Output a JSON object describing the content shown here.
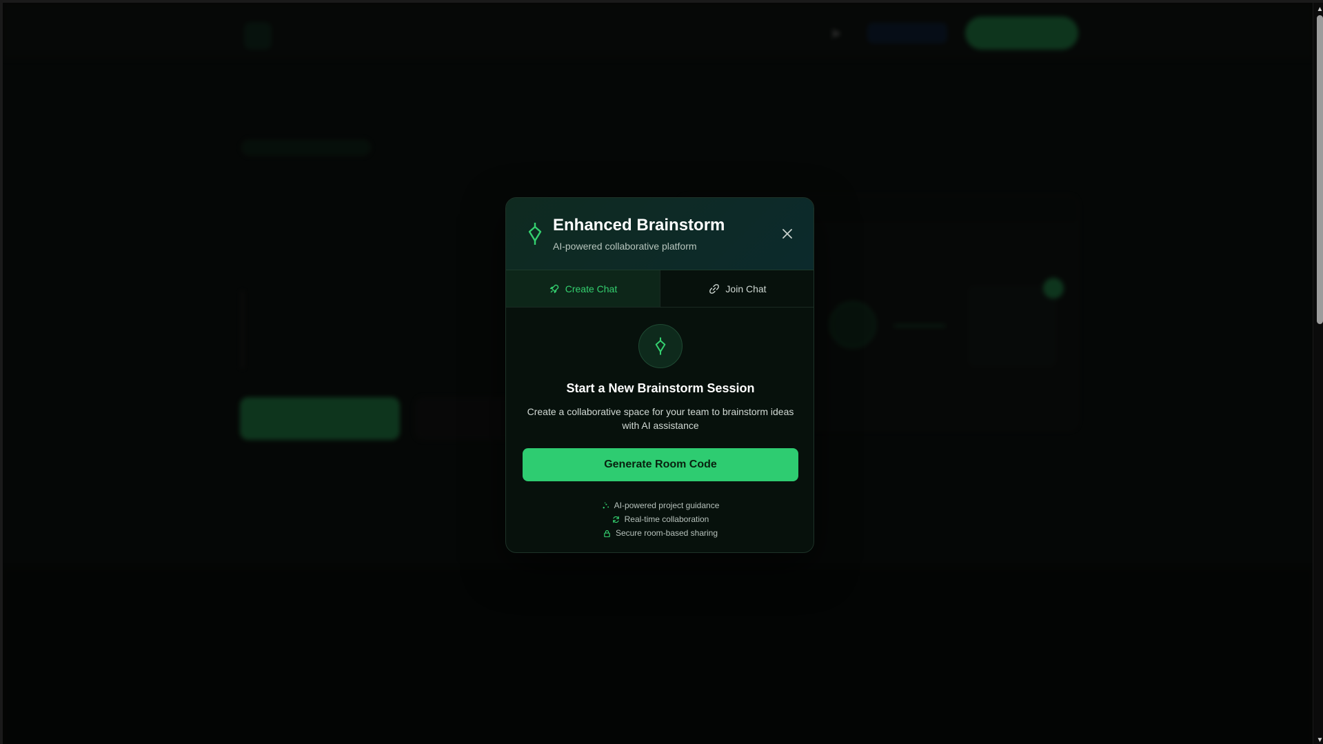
{
  "colors": {
    "accent": "#2ecc71",
    "accent_text": "#34d06f",
    "modal_bg": "#07110c",
    "header_gradient_start": "#0f2a20",
    "header_gradient_end": "#0c2a2c"
  },
  "modal": {
    "title": "Enhanced Brainstorm",
    "subtitle": "AI-powered collaborative platform",
    "header_icon": "brainstorm-node-icon",
    "close_icon": "close-icon",
    "tabs": [
      {
        "label": "Create Chat",
        "icon": "rocket-icon",
        "active": true
      },
      {
        "label": "Join Chat",
        "icon": "link-icon",
        "active": false
      }
    ],
    "session": {
      "icon": "brainstorm-node-icon",
      "title": "Start a New Brainstorm Session",
      "description": "Create a collaborative space for your team to brainstorm ideas with AI assistance"
    },
    "primary_button": "Generate Room Code",
    "features": [
      {
        "icon": "sparkle-icon",
        "label": "AI-powered project guidance"
      },
      {
        "icon": "refresh-icon",
        "label": "Real-time collaboration"
      },
      {
        "icon": "lock-icon",
        "label": "Secure room-based sharing"
      }
    ]
  }
}
